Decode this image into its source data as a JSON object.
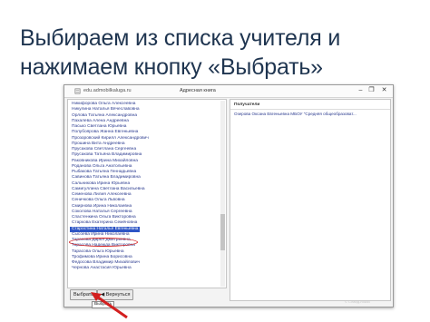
{
  "slide": {
    "title_line1": "Выбираем из списка учителя и",
    "title_line2": "нажимаем кнопку «Выбрать»"
  },
  "window": {
    "url": "edu.admobilkaluga.ru",
    "title": "Адресная книга",
    "controls": [
      "–",
      "❐",
      "✕"
    ]
  },
  "teacher_list": [
    "Никифорова Ольга Алексеевна",
    "Никулина Наталья Вячеславовна",
    "Орлова Татьяна Александровна",
    "Пахалева Алена Андреевна",
    "Пасько Светлана Юрьевна",
    "Полубоярова Жанна Евгеньевна",
    "Прозоровский Кирилл Александрович",
    "Прошина Вита Андреевна",
    "Прусакова Светлана Сергеевна",
    "Прусакова Татьяна Владимировна",
    "Раковникова Ирина Михайловна",
    "Роданова Ольга Анатольевна",
    "Рыбакова Татьяна Геннадьевна",
    "Савинова Татьяна Владимировна",
    "Сальникова Ирина Юрьевна",
    "Самигуллина Светлана Васильевна",
    "Семенова Лилия Алексеевна",
    "Сеничкова Ольга Львовна",
    "Смирнова Ирина Николаевна",
    "Соколова Наталья Сергеевна",
    "Спастенкина Ольга Викторовна",
    "Старкова Екатерина Семёновна",
    "Старостина Наталья Евгеньевна",
    "Сысоева Ирина Николаевна",
    "Тарасова Дарья Дмитриевна",
    "Тарасова Надежда Викторовна",
    "Тарасова Ольга Юрьевна",
    "Трофимова Ирина Борисовна",
    "Федосова Владимир Михайлович",
    "Чернова Анастасия Юрьевна"
  ],
  "selected_index": 22,
  "recipients": {
    "header": "Получатели",
    "items": [
      "Озерова Оксана Евгеньевна МБОУ \"Средняя общеобразоват..."
    ]
  },
  "buttons": {
    "select_label": "Выбрать",
    "back_label": "Вернуться",
    "back_icon": "◀"
  },
  "tooltip": "Выбрать",
  "watermark": "© Слайд-показ",
  "colors": {
    "title": "#1f3550",
    "list_text": "#2b3b8f",
    "selection": "#2d55c5",
    "annotation": "#d31f1f"
  }
}
